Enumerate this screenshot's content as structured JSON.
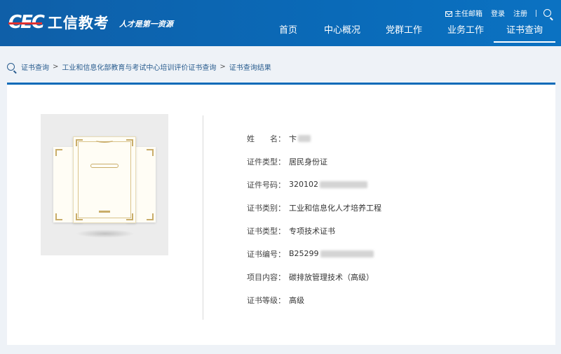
{
  "header": {
    "logo_mark": "CEC",
    "logo_name": "工信教考",
    "slogan": "人才是第一资源",
    "top_links": {
      "mailbox": "主任邮箱",
      "login": "登录",
      "register": "注册"
    },
    "nav": [
      {
        "label": "首页"
      },
      {
        "label": "中心概况"
      },
      {
        "label": "党群工作"
      },
      {
        "label": "业务工作"
      },
      {
        "label": "证书查询"
      }
    ]
  },
  "breadcrumb": {
    "items": [
      "证书查询",
      "工业和信息化部教育与考试中心培训评价证书查询",
      "证书查询结果"
    ],
    "separator": ">"
  },
  "certificate": {
    "fields": [
      {
        "label": "姓　　名：",
        "value": "卞"
      },
      {
        "label": "证件类型：",
        "value": "居民身份证"
      },
      {
        "label": "证件号码：",
        "value": "320102"
      },
      {
        "label": "证书类别：",
        "value": "工业和信息化人才培养工程"
      },
      {
        "label": "证书类型：",
        "value": "专项技术证书"
      },
      {
        "label": "证书编号：",
        "value": "B25299"
      },
      {
        "label": "项目内容：",
        "value": "碳排放管理技术（高级）"
      },
      {
        "label": "证书等级：",
        "value": "高级"
      }
    ]
  },
  "colors": {
    "header_blue": "#0a6ab8",
    "breadcrumb_text": "#2a5d8f",
    "card_border": "#0a6ab8"
  }
}
